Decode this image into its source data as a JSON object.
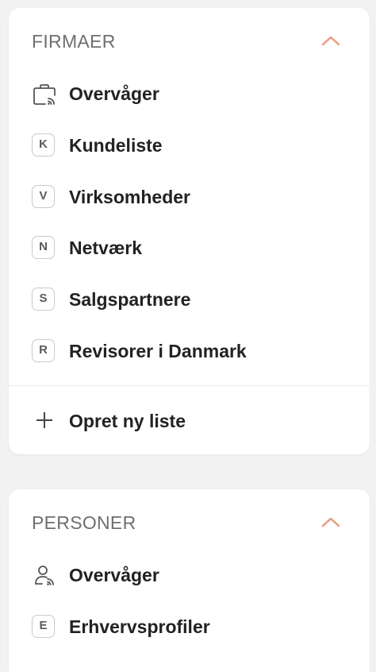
{
  "colors": {
    "accent": "#e8a287",
    "title": "#6f6f6f",
    "text": "#222222",
    "icon_border": "#c9c9c9"
  },
  "firmaer": {
    "title": "FIRMAER",
    "collapse_icon": "chevron-up-icon",
    "items": [
      {
        "icon": "briefcase-monitor-icon",
        "label": "Overvåger"
      },
      {
        "letter": "K",
        "label": "Kundeliste"
      },
      {
        "letter": "V",
        "label": "Virksomheder"
      },
      {
        "letter": "N",
        "label": "Netværk"
      },
      {
        "letter": "S",
        "label": "Salgspartnere"
      },
      {
        "letter": "R",
        "label": "Revisorer i Danmark"
      }
    ],
    "create": {
      "icon": "plus-icon",
      "label": "Opret ny liste"
    }
  },
  "personer": {
    "title": "PERSONER",
    "collapse_icon": "chevron-up-icon",
    "items": [
      {
        "icon": "person-monitor-icon",
        "label": "Overvåger"
      },
      {
        "letter": "E",
        "label": "Erhvervsprofiler"
      }
    ]
  }
}
